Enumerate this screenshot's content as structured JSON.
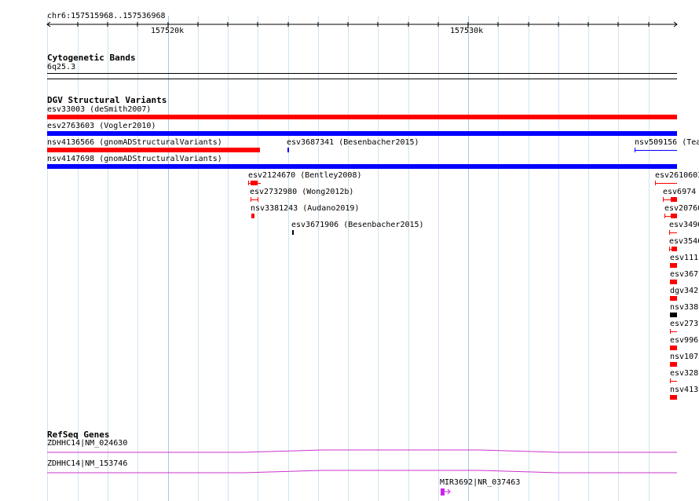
{
  "ruler": {
    "locus": "chr6:157515968..157536968",
    "ticks": [
      "157520k",
      "157530k"
    ]
  },
  "cytobands": {
    "title": "Cytogenetic Bands",
    "band": "6q25.3"
  },
  "dgv": {
    "title": "DGV Structural Variants",
    "variants": [
      "esv33003 (deSmith2007)",
      "esv2763603 (Vogler2010)",
      "nsv4136566 (gnomADStructuralVariants)",
      "esv3687341 (Besenbacher2015)",
      "nsv509156 (Tea",
      "nsv4147698 (gnomADStructuralVariants)",
      "esv2124670 (Bentley2008)",
      "esv2610603",
      "esv2732980 (Wong2012b)",
      "esv6974",
      "nsv3381243 (Audano2019)",
      "esv20760",
      "esv3671906 (Besenbacher2015)",
      "esv3496",
      "esv3546",
      "esv111",
      "esv367",
      "dgv342",
      "nsv338",
      "esv273",
      "esv996",
      "nsv107",
      "esv328",
      "nsv413"
    ],
    "colors": {
      "loss": "#ff0000",
      "gain": "#0000ff",
      "complex": "#000000"
    }
  },
  "refseq": {
    "title": "RefSeq Genes",
    "genes": [
      "ZDHHC14|NM_024630",
      "ZDHHC14|NM_153746",
      "MIR3692|NR_037463"
    ],
    "colors": {
      "coding": "#cc33cc",
      "mirna": "#cc22ee"
    }
  }
}
